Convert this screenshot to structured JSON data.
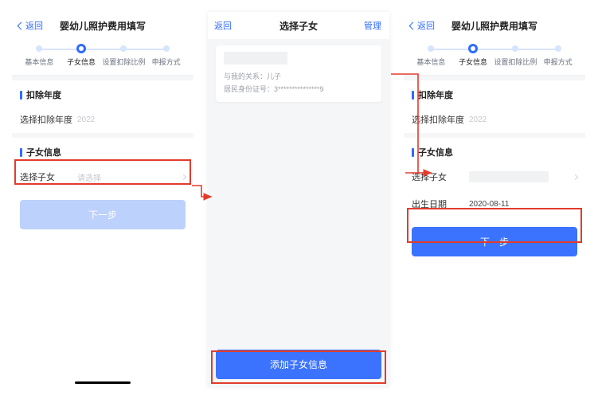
{
  "screens": {
    "s1": {
      "back": "返回",
      "title": "婴幼儿照护费用填写",
      "stepper": {
        "s0": "基本信息",
        "s1": "子女信息",
        "s2": "设置扣除比例",
        "s3": "申报方式"
      },
      "section_year": "扣除年度",
      "row_year_label": "选择扣除年度",
      "row_year_value": "2022",
      "section_child": "子女信息",
      "row_select_child_label": "选择子女",
      "row_select_child_placeholder": "请选择",
      "next_btn": "下一步"
    },
    "s2": {
      "back": "返回",
      "title": "选择子女",
      "manage": "管理",
      "card_relation_label": "与我的关系：",
      "card_relation_value": "儿子",
      "card_id_label": "居民身份证号：",
      "card_id_value": "3***************9",
      "add_btn": "添加子女信息"
    },
    "s3": {
      "back": "返回",
      "title": "婴幼儿照护费用填写",
      "stepper": {
        "s0": "基本信息",
        "s1": "子女信息",
        "s2": "设置扣除比例",
        "s3": "申报方式"
      },
      "section_year": "扣除年度",
      "row_year_label": "选择扣除年度",
      "row_year_value": "2022",
      "section_child": "子女信息",
      "row_select_child_label": "选择子女",
      "row_dob_label": "出生日期",
      "row_dob_value": "2020-08-11",
      "next_btn": "下一步"
    }
  }
}
